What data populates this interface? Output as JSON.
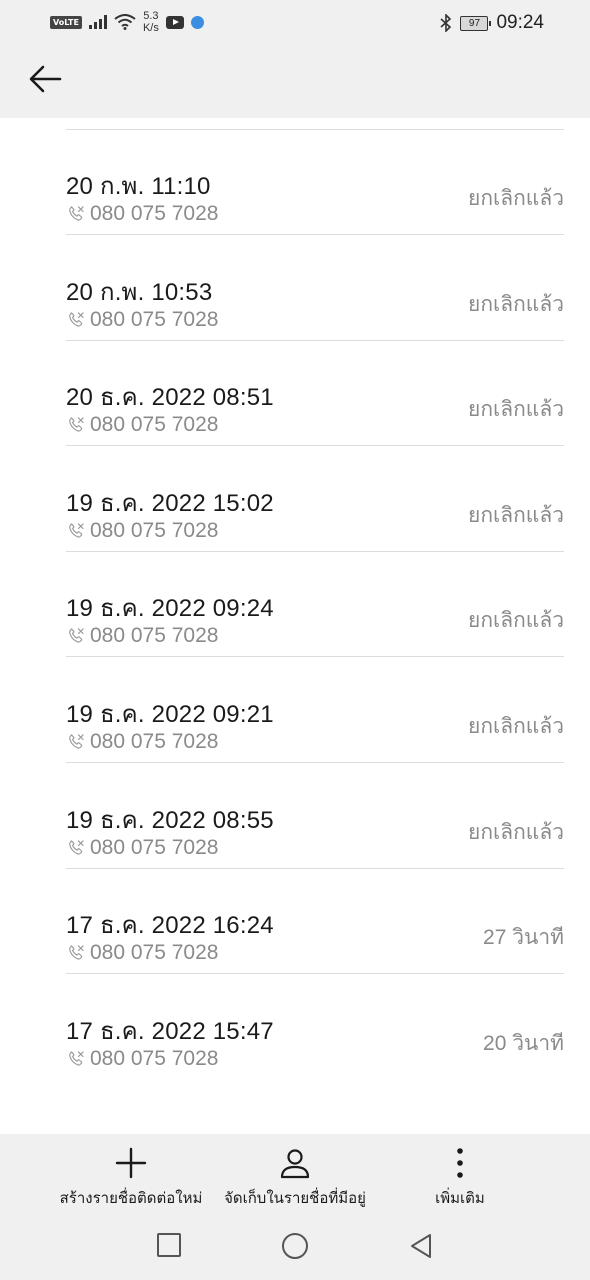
{
  "status_bar": {
    "volte": "VoLTE",
    "speed_value": "5.3",
    "speed_unit": "K/s",
    "battery": "97",
    "time": "09:24"
  },
  "toolbar": {
    "back_icon": "arrow-left-icon"
  },
  "calls": [
    {
      "date": "20 ก.พ. 11:10",
      "number": "080 075 7028",
      "status": "ยกเลิกแล้ว"
    },
    {
      "date": "20 ก.พ. 10:53",
      "number": "080 075 7028",
      "status": "ยกเลิกแล้ว"
    },
    {
      "date": "20 ธ.ค. 2022 08:51",
      "number": "080 075 7028",
      "status": "ยกเลิกแล้ว"
    },
    {
      "date": "19 ธ.ค. 2022 15:02",
      "number": "080 075 7028",
      "status": "ยกเลิกแล้ว"
    },
    {
      "date": "19 ธ.ค. 2022 09:24",
      "number": "080 075 7028",
      "status": "ยกเลิกแล้ว"
    },
    {
      "date": "19 ธ.ค. 2022 09:21",
      "number": "080 075 7028",
      "status": "ยกเลิกแล้ว"
    },
    {
      "date": "19 ธ.ค. 2022 08:55",
      "number": "080 075 7028",
      "status": "ยกเลิกแล้ว"
    },
    {
      "date": "17 ธ.ค. 2022 16:24",
      "number": "080 075 7028",
      "status": "27 วินาที"
    },
    {
      "date": "17 ธ.ค. 2022 15:47",
      "number": "080 075 7028",
      "status": "20 วินาที"
    }
  ],
  "actions": {
    "create": "สร้างรายชื่อติดต่อใหม่",
    "save": "จัดเก็บในรายชื่อที่มีอยู่",
    "more": "เพิ่มเติม"
  },
  "colors": {
    "bar_bg": "#f0f0f0",
    "secondary_text": "#8a8a8a",
    "divider": "#dcdcdc"
  }
}
